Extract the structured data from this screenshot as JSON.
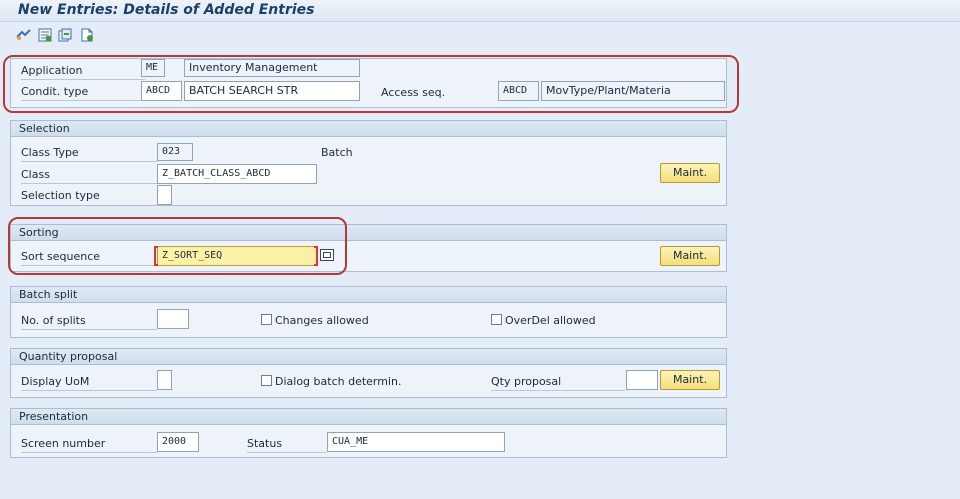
{
  "window": {
    "title": "New Entries: Details of Added Entries"
  },
  "toolbar": {
    "icons": [
      "display-change-icon",
      "select-list-icon",
      "copy-icon",
      "new-entries-icon"
    ]
  },
  "header": {
    "application_label": "Application",
    "application_code": "ME",
    "application_desc": "Inventory Management",
    "condit_type_label": "Condit. type",
    "condit_type_code": "ABCD",
    "condit_type_desc": "BATCH SEARCH STR",
    "access_seq_label": "Access seq.",
    "access_seq_code": "ABCD",
    "access_seq_desc": "MovType/Plant/Materia"
  },
  "selection": {
    "title": "Selection",
    "class_type_label": "Class Type",
    "class_type_value": "023",
    "class_type_desc": "Batch",
    "class_label": "Class",
    "class_value": "Z_BATCH_CLASS_ABCD",
    "selection_type_label": "Selection type",
    "selection_type_value": "",
    "maint_label": "Maint."
  },
  "sorting": {
    "title": "Sorting",
    "sort_seq_label": "Sort sequence",
    "sort_seq_value": "Z_SORT_SEQ",
    "maint_label": "Maint."
  },
  "batch_split": {
    "title": "Batch split",
    "splits_label": "No. of splits",
    "splits_value": "",
    "changes_allowed_label": "Changes allowed",
    "overdel_allowed_label": "OverDel allowed"
  },
  "quantity_proposal": {
    "title": "Quantity proposal",
    "display_uom_label": "Display UoM",
    "display_uom_value": "",
    "dialog_batch_label": "Dialog batch determin.",
    "qty_proposal_label": "Qty proposal",
    "qty_proposal_value": "",
    "maint_label": "Maint."
  },
  "presentation": {
    "title": "Presentation",
    "screen_number_label": "Screen number",
    "screen_number_value": "2000",
    "status_label": "Status",
    "status_value": "CUA_ME"
  },
  "colors": {
    "highlight": "#b43a3a",
    "required_field": "#fbf2a8",
    "button": "#f3df7a"
  }
}
